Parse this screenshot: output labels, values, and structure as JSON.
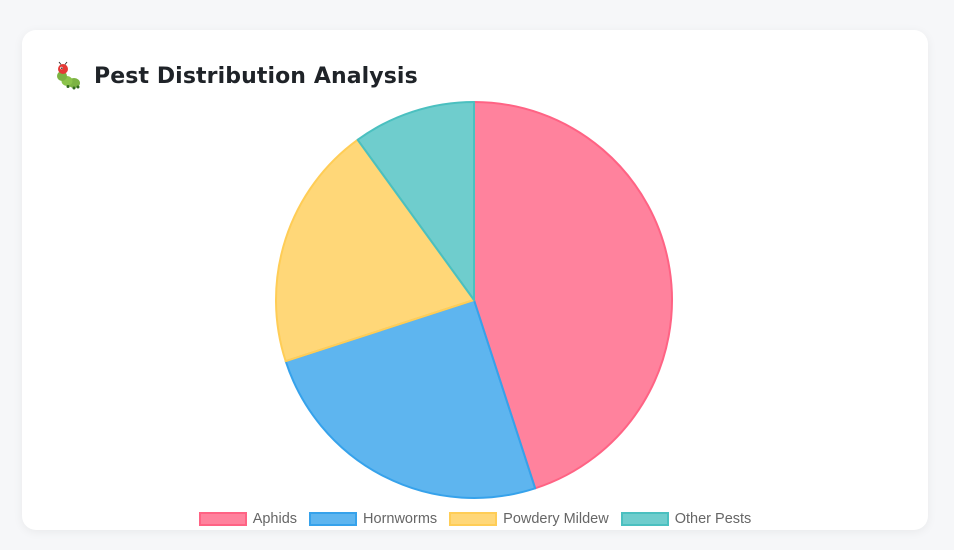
{
  "page": {
    "title": "Pest Distribution Analysis",
    "title_icon": "caterpillar-icon"
  },
  "chart_data": {
    "type": "pie",
    "categories": [
      "Aphids",
      "Hornworms",
      "Powdery Mildew",
      "Other Pests"
    ],
    "values": [
      45,
      25,
      20,
      10
    ],
    "colors": {
      "fill": [
        "#ff6384",
        "#36a2eb",
        "#ffcd56",
        "#4bc0c0"
      ],
      "border": [
        "#ff6384",
        "#36a2eb",
        "#ffcd56",
        "#4bc0c0"
      ]
    },
    "legend_position": "bottom"
  }
}
